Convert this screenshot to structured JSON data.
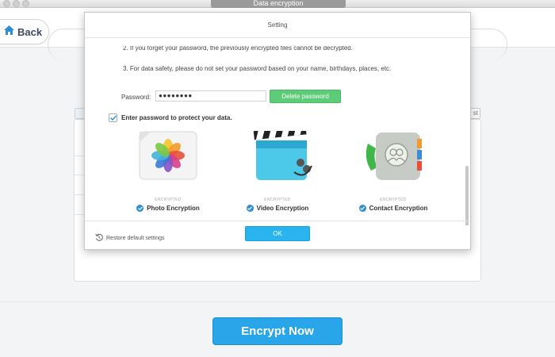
{
  "window": {
    "title": "Data encryption"
  },
  "header": {
    "back_label": "Back"
  },
  "background": {
    "right_button_fragment": "st"
  },
  "main": {
    "encrypt_now_label": "Encrypt Now"
  },
  "dialog": {
    "title": "Setting",
    "notes": [
      "2. If you forget your password, the previously encrypted files cannot be decrypted.",
      "3. For data safety, please do not set your password based on your name, birthdays, places, etc."
    ],
    "password_label": "Password:",
    "password_value": "●●●●●●●●",
    "delete_password_label": "Delete password",
    "protect_label": "Enter  password to protect your data.",
    "options": [
      {
        "status": "ENCRYPTED",
        "label": "Photo Encryption",
        "icon": "photos-app-icon"
      },
      {
        "status": "ENCRYPTED",
        "label": "Video Encryption",
        "icon": "video-clapper-icon"
      },
      {
        "status": "ENCRYPTED",
        "label": "Contact Encryption",
        "icon": "contacts-app-icon"
      }
    ],
    "restore_label": "Restore default settings",
    "ok_label": "OK"
  },
  "colors": {
    "accent_blue": "#29a5ea",
    "delete_green": "#5ccc77",
    "check_blue": "#2d8ed8"
  }
}
